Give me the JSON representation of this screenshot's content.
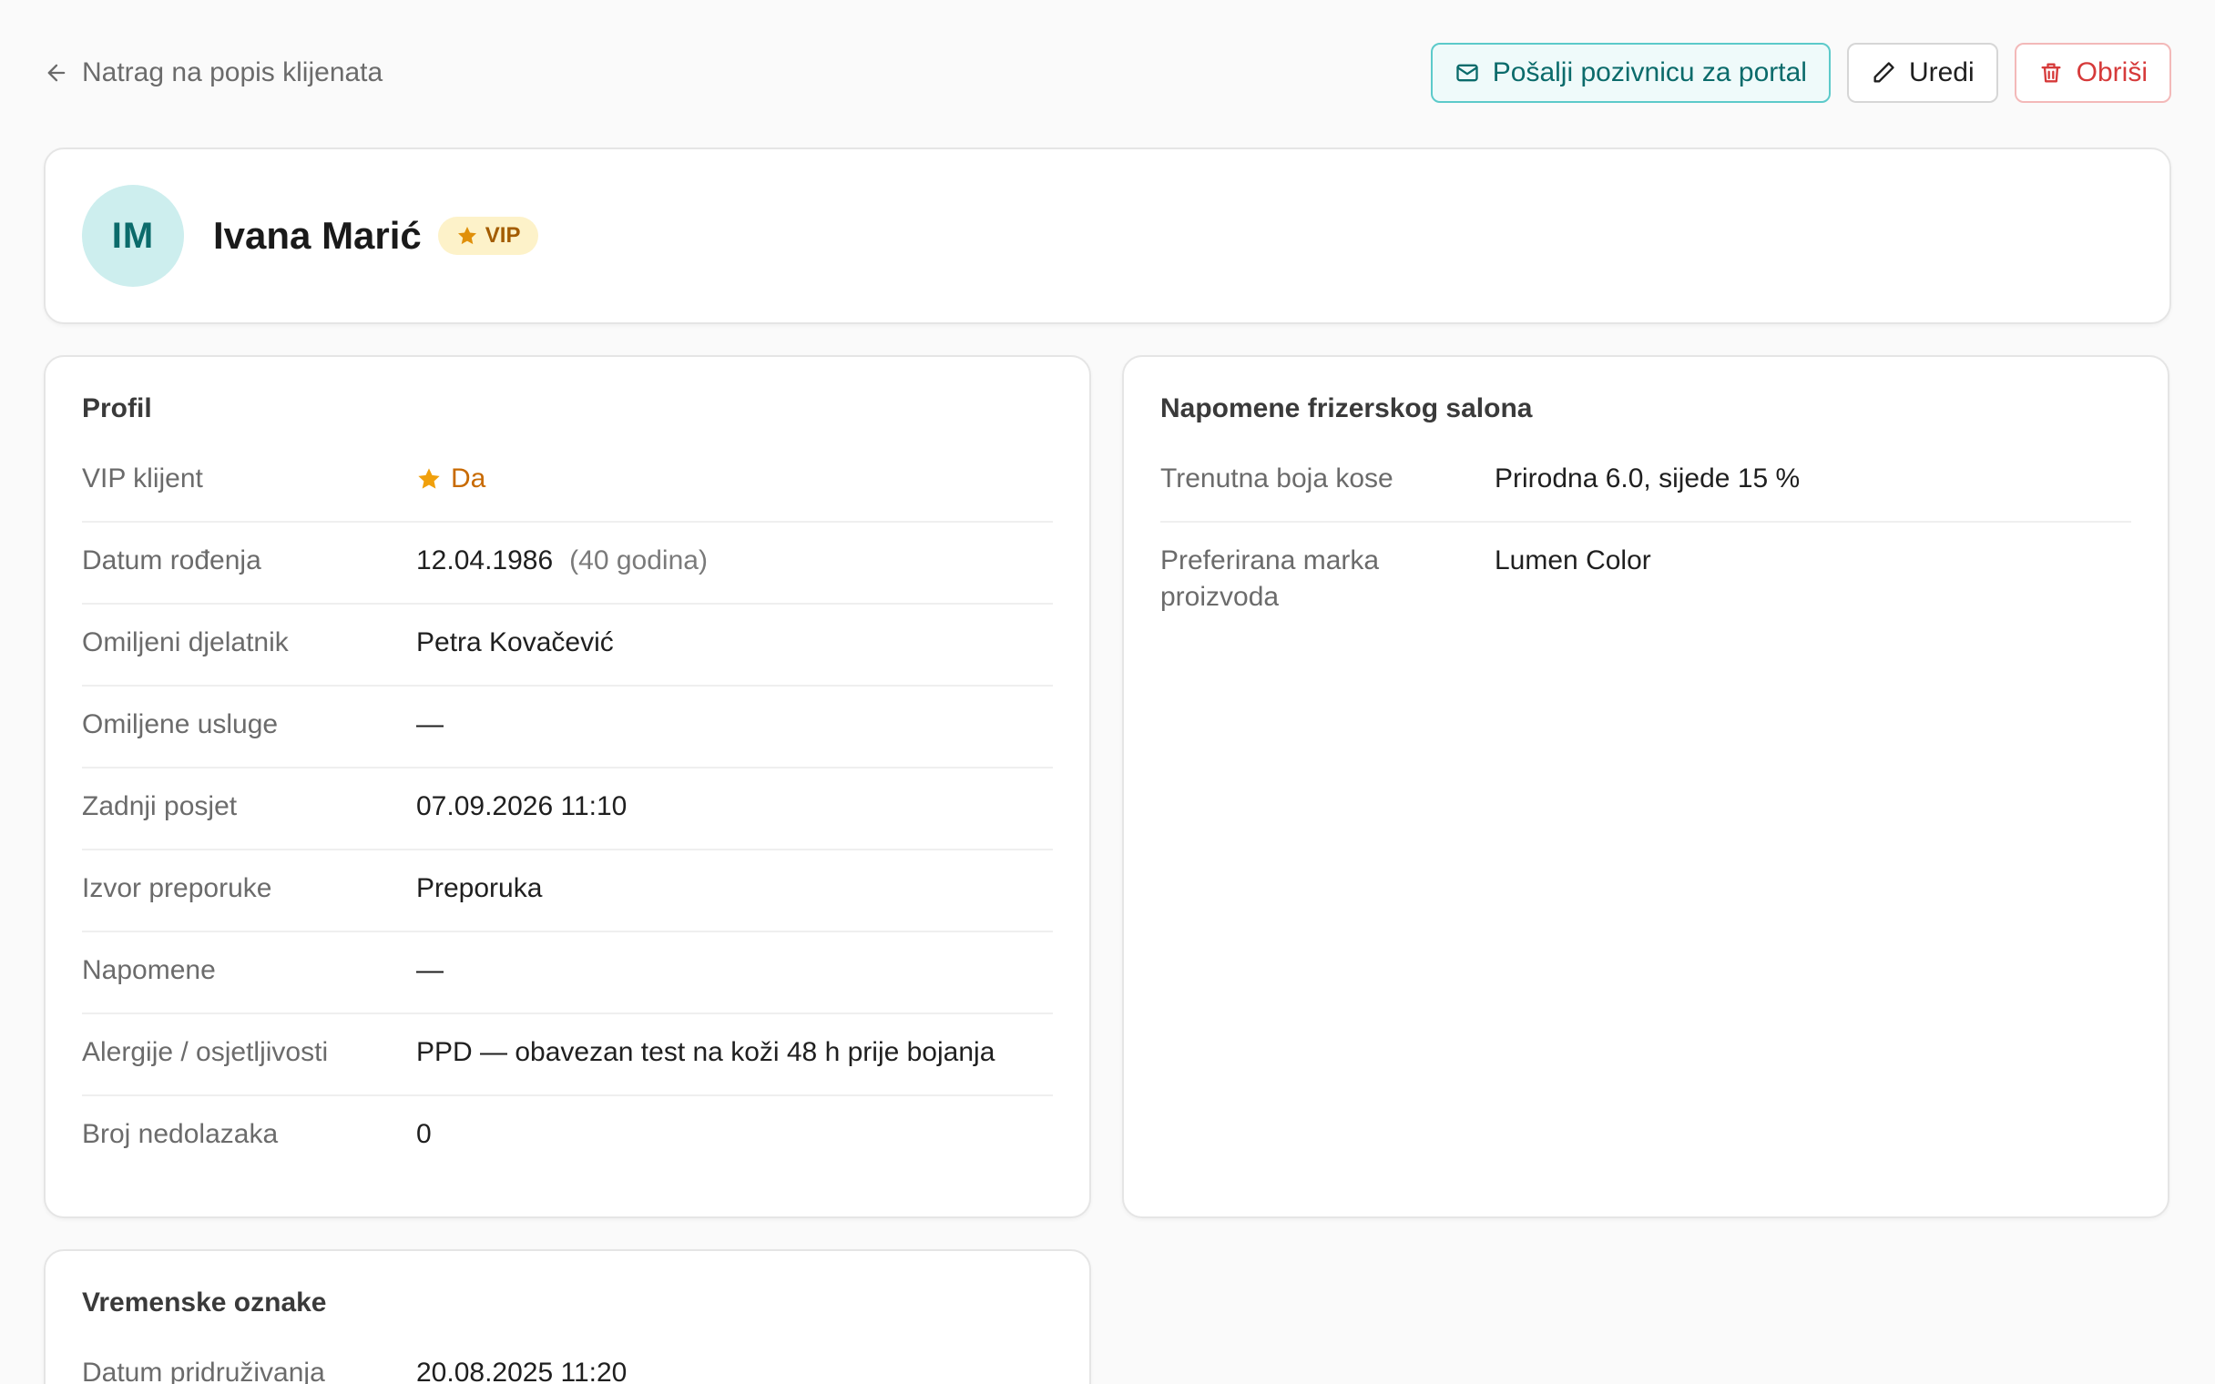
{
  "nav": {
    "back_label": "Natrag na popis klijenata"
  },
  "actions": {
    "invite_label": "Pošalji pozivnicu za portal",
    "edit_label": "Uredi",
    "delete_label": "Obriši"
  },
  "client": {
    "initials": "IM",
    "name": "Ivana Marić",
    "badge": "VIP"
  },
  "profile": {
    "title": "Profil",
    "rows": [
      {
        "label": "VIP klijent",
        "value": "Da"
      },
      {
        "label": "Datum rođenja",
        "value": "12.04.1986",
        "extra": "(40 godina)"
      },
      {
        "label": "Omiljeni djelatnik",
        "value": "Petra Kovačević"
      },
      {
        "label": "Omiljene usluge",
        "value": "—"
      },
      {
        "label": "Zadnji posjet",
        "value": "07.09.2026 11:10"
      },
      {
        "label": "Izvor preporuke",
        "value": "Preporuka"
      },
      {
        "label": "Napomene",
        "value": "—"
      },
      {
        "label": "Alergije / osjetljivosti",
        "value": "PPD — obavezan test na koži 48 h prije bojanja"
      },
      {
        "label": "Broj nedolazaka",
        "value": "0"
      }
    ]
  },
  "salon_notes": {
    "title": "Napomene frizerskog salona",
    "rows": [
      {
        "label": "Trenutna boja kose",
        "value": "Prirodna 6.0, sijede 15 %"
      },
      {
        "label": "Preferirana marka proizvoda",
        "value": "Lumen Color"
      }
    ]
  },
  "timestamps": {
    "title": "Vremenske oznake",
    "rows": [
      {
        "label": "Datum pridruživanja",
        "value": "20.08.2025 11:20"
      }
    ]
  },
  "colors": {
    "accent": "#0b6b6b",
    "vip": "#c86a00",
    "danger": "#d63a3a"
  }
}
